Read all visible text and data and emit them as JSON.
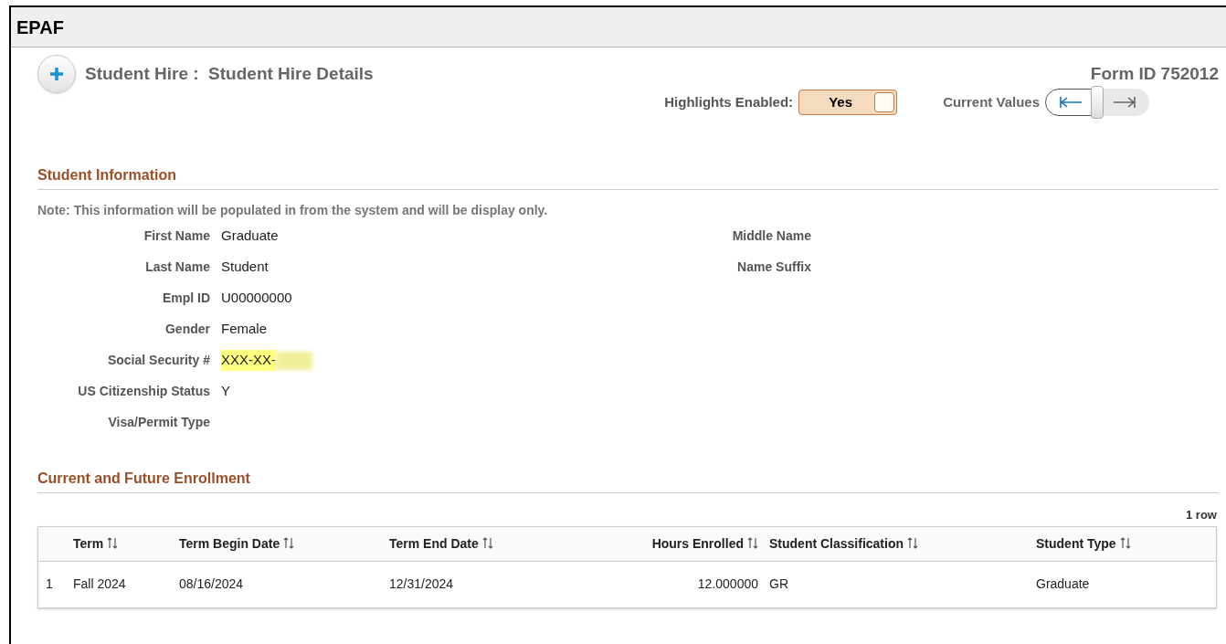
{
  "window": {
    "title": "EPAF"
  },
  "header": {
    "title": "Student Hire :  Student Hire Details",
    "form_id_label": "Form ID",
    "form_id": "752012"
  },
  "highlights": {
    "label": "Highlights Enabled:",
    "value": "Yes",
    "on": true
  },
  "current_values": {
    "label": "Current Values",
    "on": true
  },
  "student_information": {
    "heading": "Student Information",
    "note": "Note: This information will be populated in from the system and will be display only.",
    "left_fields": [
      {
        "label": "First Name",
        "value": "Graduate"
      },
      {
        "label": "Last Name",
        "value": "Student"
      },
      {
        "label": "Empl ID",
        "value": "U00000000"
      },
      {
        "label": "Gender",
        "value": "Female"
      },
      {
        "label": "Social Security #",
        "value": "XXX-XX-",
        "highlighted": true
      },
      {
        "label": "US Citizenship Status",
        "value": "Y"
      },
      {
        "label": "Visa/Permit Type"
      }
    ],
    "right_fields": [
      {
        "label": "Middle Name"
      },
      {
        "label": "Name Suffix"
      }
    ]
  },
  "enrollment": {
    "heading": "Current and Future Enrollment",
    "row_count": "1 row",
    "columns": [
      {
        "label": "Term"
      },
      {
        "label": "Term Begin Date"
      },
      {
        "label": "Term End Date"
      },
      {
        "label": "Hours Enrolled"
      },
      {
        "label": "Student Classification"
      },
      {
        "label": "Student Type"
      }
    ],
    "rows": [
      {
        "number": "1",
        "cells": [
          "Fall 2024",
          "08/16/2024",
          "12/31/2024",
          "12.000000",
          "GR",
          "Graduate"
        ]
      }
    ]
  }
}
